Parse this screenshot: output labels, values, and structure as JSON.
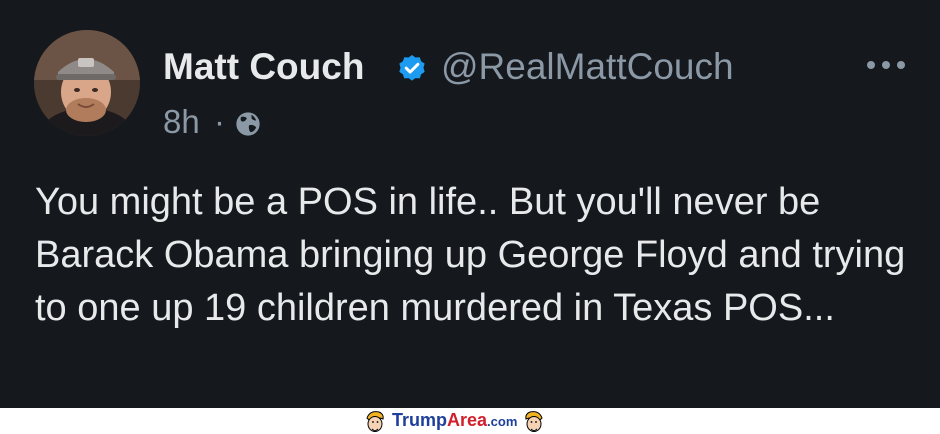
{
  "tweet": {
    "display_name": "Matt Couch",
    "handle": "@RealMattCouch",
    "timestamp": "8h",
    "separator": "·",
    "body": "You might be a POS in life.. But you'll never be Barack Obama bringing up George Floyd and trying to one up 19 children murdered in Texas POS...",
    "icons": {
      "verified": "verified-badge-icon",
      "privacy": "globe-icon",
      "more": "more-options-icon"
    },
    "colors": {
      "background": "#15181c",
      "primary_text": "#e7e9ea",
      "secondary_text": "#8b98a5",
      "verified_blue": "#1d9bf0"
    }
  },
  "watermark": {
    "brand_part1": "Trump",
    "brand_part2": "Area",
    "brand_part3": ".com",
    "colors": {
      "blue": "#1e3f9c",
      "red": "#d11f2c"
    }
  }
}
